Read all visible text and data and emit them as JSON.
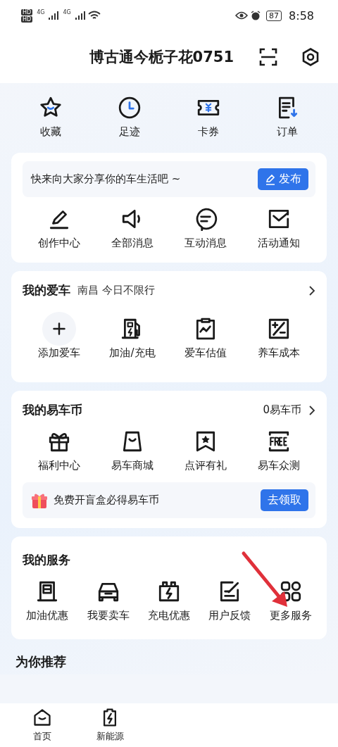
{
  "status_bar": {
    "sim_labels": [
      "HD",
      "HD"
    ],
    "network_labels": [
      "4G",
      "4G"
    ],
    "battery": "87",
    "time": "8:58"
  },
  "header": {
    "title": "博古通今栀子花0751"
  },
  "quick_links": [
    "收藏",
    "足迹",
    "卡券",
    "订单"
  ],
  "share_card": {
    "prompt": "快来向大家分享你的车生活吧 ~",
    "button": "发布",
    "items": [
      "创作中心",
      "全部消息",
      "互动消息",
      "活动通知"
    ]
  },
  "car_card": {
    "title": "我的爱车",
    "subtitle": "南昌 今日不限行",
    "items": [
      "添加爱车",
      "加油/充电",
      "爱车估值",
      "养车成本"
    ]
  },
  "coin_card": {
    "title": "我的易车币",
    "balance": "0易车币",
    "items": [
      "福利中心",
      "易车商城",
      "点评有礼",
      "易车众测"
    ],
    "promo": {
      "text": "免费开盲盒必得易车币",
      "button": "去领取"
    }
  },
  "services_card": {
    "title": "我的服务",
    "items": [
      "加油优惠",
      "我要卖车",
      "充电优惠",
      "用户反馈",
      "更多服务"
    ]
  },
  "recommend": {
    "title": "为你推荐"
  },
  "bottom_nav": [
    "首页",
    "新能源"
  ]
}
